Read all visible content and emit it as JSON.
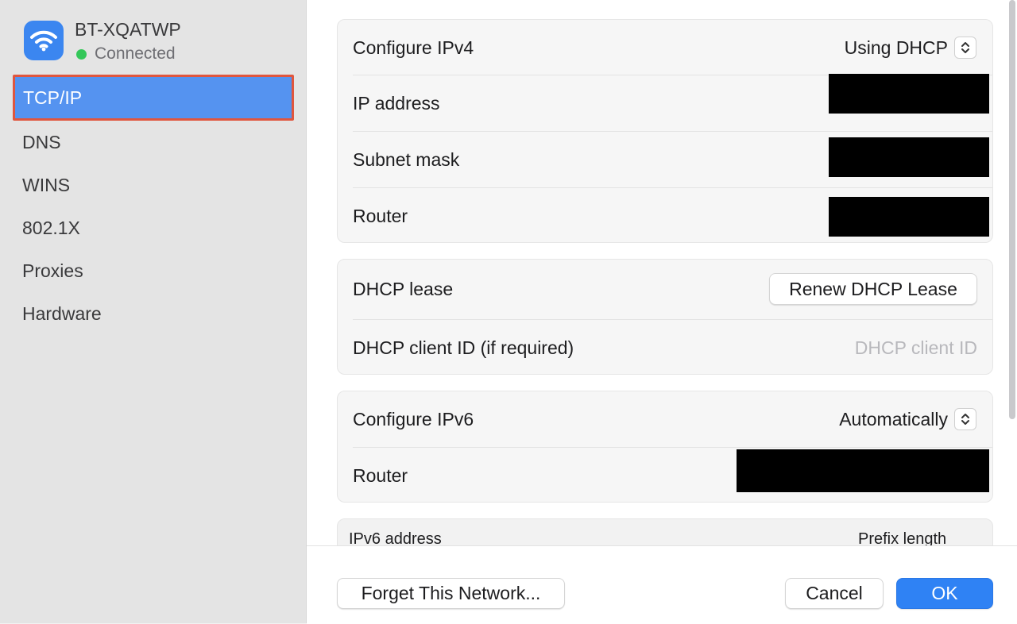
{
  "network": {
    "name": "BT-XQATWP",
    "status": "Connected",
    "status_color": "#34c759"
  },
  "sidebar": {
    "items": [
      {
        "label": "TCP/IP",
        "selected": true
      },
      {
        "label": "DNS"
      },
      {
        "label": "WINS"
      },
      {
        "label": "802.1X"
      },
      {
        "label": "Proxies"
      },
      {
        "label": "Hardware"
      }
    ]
  },
  "ipv4": {
    "configure_label": "Configure IPv4",
    "configure_value": "Using DHCP",
    "ip_label": "IP address",
    "subnet_label": "Subnet mask",
    "router_label": "Router"
  },
  "dhcp": {
    "lease_label": "DHCP lease",
    "renew_button": "Renew DHCP Lease",
    "client_id_label": "DHCP client ID (if required)",
    "client_id_placeholder": "DHCP client ID"
  },
  "ipv6": {
    "configure_label": "Configure IPv6",
    "configure_value": "Automatically",
    "router_label": "Router"
  },
  "ipv6_table": {
    "col_address": "IPv6 address",
    "col_prefix": "Prefix length"
  },
  "footer": {
    "forget_button": "Forget This Network...",
    "cancel_button": "Cancel",
    "ok_button": "OK"
  },
  "colors": {
    "accent": "#2f82f4",
    "selection_outline": "#e0563e"
  }
}
